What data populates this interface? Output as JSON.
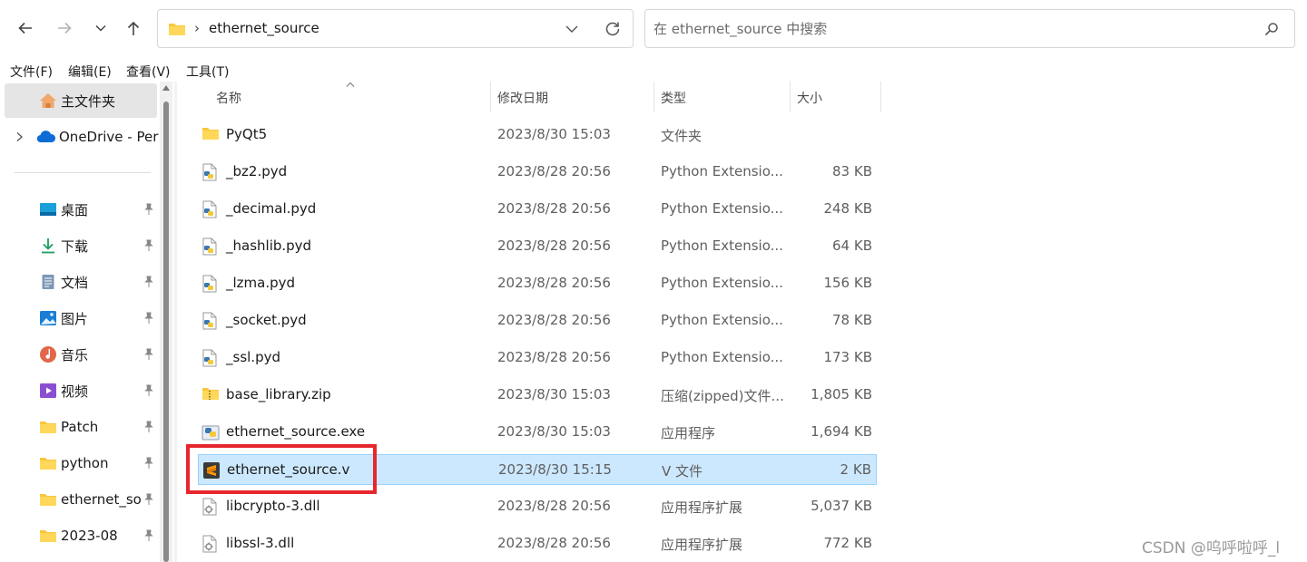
{
  "address": {
    "path": "ethernet_source",
    "separator": "›"
  },
  "search": {
    "placeholder": "在 ethernet_source 中搜索"
  },
  "menu": [
    "文件(F)",
    "编辑(E)",
    "查看(V)",
    "工具(T)"
  ],
  "nav": {
    "home": "主文件夹",
    "onedrive": "OneDrive - Per",
    "quick": [
      "桌面",
      "下载",
      "文档",
      "图片",
      "音乐",
      "视频",
      "Patch",
      "python",
      "ethernet_so",
      "2023-08"
    ]
  },
  "columns": {
    "name": "名称",
    "date": "修改日期",
    "type": "类型",
    "size": "大小"
  },
  "files": [
    {
      "name": "PyQt5",
      "date": "2023/8/30 15:03",
      "type": "文件夹",
      "size": "",
      "icon": "folder-icon"
    },
    {
      "name": "_bz2.pyd",
      "date": "2023/8/28 20:56",
      "type": "Python Extensio...",
      "size": "83 KB",
      "icon": "python-file-icon"
    },
    {
      "name": "_decimal.pyd",
      "date": "2023/8/28 20:56",
      "type": "Python Extensio...",
      "size": "248 KB",
      "icon": "python-file-icon"
    },
    {
      "name": "_hashlib.pyd",
      "date": "2023/8/28 20:56",
      "type": "Python Extensio...",
      "size": "64 KB",
      "icon": "python-file-icon"
    },
    {
      "name": "_lzma.pyd",
      "date": "2023/8/28 20:56",
      "type": "Python Extensio...",
      "size": "156 KB",
      "icon": "python-file-icon"
    },
    {
      "name": "_socket.pyd",
      "date": "2023/8/28 20:56",
      "type": "Python Extensio...",
      "size": "78 KB",
      "icon": "python-file-icon"
    },
    {
      "name": "_ssl.pyd",
      "date": "2023/8/28 20:56",
      "type": "Python Extensio...",
      "size": "173 KB",
      "icon": "python-file-icon"
    },
    {
      "name": "base_library.zip",
      "date": "2023/8/30 15:03",
      "type": "压缩(zipped)文件...",
      "size": "1,805 KB",
      "icon": "zip-folder-icon"
    },
    {
      "name": "ethernet_source.exe",
      "date": "2023/8/30 15:03",
      "type": "应用程序",
      "size": "1,694 KB",
      "icon": "exe-icon"
    },
    {
      "name": "ethernet_source.v",
      "date": "2023/8/30 15:15",
      "type": "V 文件",
      "size": "2 KB",
      "icon": "sublime-file-icon",
      "selected": true
    },
    {
      "name": "libcrypto-3.dll",
      "date": "2023/8/28 20:56",
      "type": "应用程序扩展",
      "size": "5,037 KB",
      "icon": "dll-icon"
    },
    {
      "name": "libssl-3.dll",
      "date": "2023/8/28 20:56",
      "type": "应用程序扩展",
      "size": "772 KB",
      "icon": "dll-icon"
    }
  ],
  "watermark": "CSDN @呜呼啦呼_l",
  "colors": {
    "selection": "#cce8ff",
    "selection_border": "#99d1ff",
    "highlight": "#e8262e",
    "folder": "#f8c73f"
  }
}
